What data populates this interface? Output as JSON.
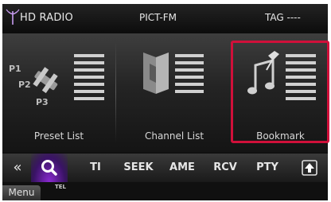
{
  "header": {
    "app_title": "HD RADIO",
    "station": "PICT-FM",
    "tag": "TAG ----"
  },
  "tiles": [
    {
      "label": "Preset List",
      "icon": "preset-list-icon",
      "preset_marks": [
        "P1",
        "P2",
        "P3"
      ]
    },
    {
      "label": "Channel List",
      "icon": "channel-list-icon"
    },
    {
      "label": "Bookmark",
      "icon": "bookmark-icon"
    }
  ],
  "toolbar": {
    "back": "«",
    "ti": "TI",
    "seek": "SEEK",
    "ame": "AME",
    "rcv": "RCV",
    "pty": "PTY"
  },
  "bottom": {
    "menu": "Menu",
    "tel": "TEL"
  },
  "colors": {
    "highlight": "#d0103a",
    "search_glow": "#8a2ad0"
  }
}
